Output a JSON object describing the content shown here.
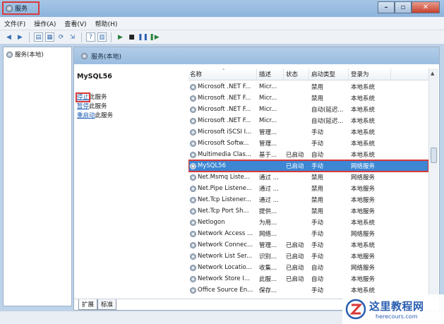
{
  "window": {
    "title": "服务"
  },
  "menu": [
    "文件(F)",
    "操作(A)",
    "查看(V)",
    "帮助(H)"
  ],
  "tree": {
    "root_label": "服务(本地)"
  },
  "pane": {
    "header": "服务(本地)"
  },
  "description": {
    "service_name": "MySQL56",
    "actions": [
      {
        "link": "停止",
        "suffix": "此服务"
      },
      {
        "link": "暂停",
        "suffix": "此服务"
      },
      {
        "link": "重启动",
        "suffix": "此服务"
      }
    ]
  },
  "table": {
    "columns": [
      "名称",
      "描述",
      "状态",
      "启动类型",
      "登录为"
    ],
    "rows": [
      [
        "Microsoft .NET F...",
        "Micr...",
        "",
        "禁用",
        "本地系统"
      ],
      [
        "Microsoft .NET F...",
        "Micr...",
        "",
        "禁用",
        "本地系统"
      ],
      [
        "Microsoft .NET F...",
        "Micr...",
        "",
        "自动(延迟...",
        "本地系统"
      ],
      [
        "Microsoft .NET F...",
        "Micr...",
        "",
        "自动(延迟...",
        "本地系统"
      ],
      [
        "Microsoft iSCSI I...",
        "管理...",
        "",
        "手动",
        "本地系统"
      ],
      [
        "Microsoft Softw...",
        "管理...",
        "",
        "手动",
        "本地系统"
      ],
      [
        "Multimedia Clas...",
        "基于...",
        "已启动",
        "自动",
        "本地系统"
      ],
      [
        "MySQL56",
        "",
        "已启动",
        "手动",
        "网络服务"
      ],
      [
        "Net.Msmq Liste...",
        "通过 ...",
        "",
        "禁用",
        "网络服务"
      ],
      [
        "Net.Pipe Listene...",
        "通过 ...",
        "",
        "禁用",
        "本地服务"
      ],
      [
        "Net.Tcp Listener...",
        "通过 ...",
        "",
        "禁用",
        "本地服务"
      ],
      [
        "Net.Tcp Port Sh...",
        "提供...",
        "",
        "禁用",
        "本地服务"
      ],
      [
        "Netlogon",
        "为用...",
        "",
        "手动",
        "本地系统"
      ],
      [
        "Network Access ...",
        "网络...",
        "",
        "手动",
        "网络服务"
      ],
      [
        "Network Connec...",
        "管理...",
        "已启动",
        "手动",
        "本地系统"
      ],
      [
        "Network List Ser...",
        "识别...",
        "已启动",
        "手动",
        "本地服务"
      ],
      [
        "Network Locatio...",
        "收集...",
        "已启动",
        "自动",
        "网络服务"
      ],
      [
        "Network Store I...",
        "此服...",
        "已启动",
        "自动",
        "本地服务"
      ],
      [
        "Office Source En...",
        "保存...",
        "",
        "手动",
        "本地系统"
      ]
    ],
    "selected_index": 7
  },
  "tabs": [
    "扩展",
    "标准"
  ],
  "watermark": {
    "name": "这里教程网",
    "url": "herecours.com"
  },
  "colors": {
    "highlight": "#d8393a",
    "selection": "#3c86d3",
    "link": "#1a5cb0"
  }
}
